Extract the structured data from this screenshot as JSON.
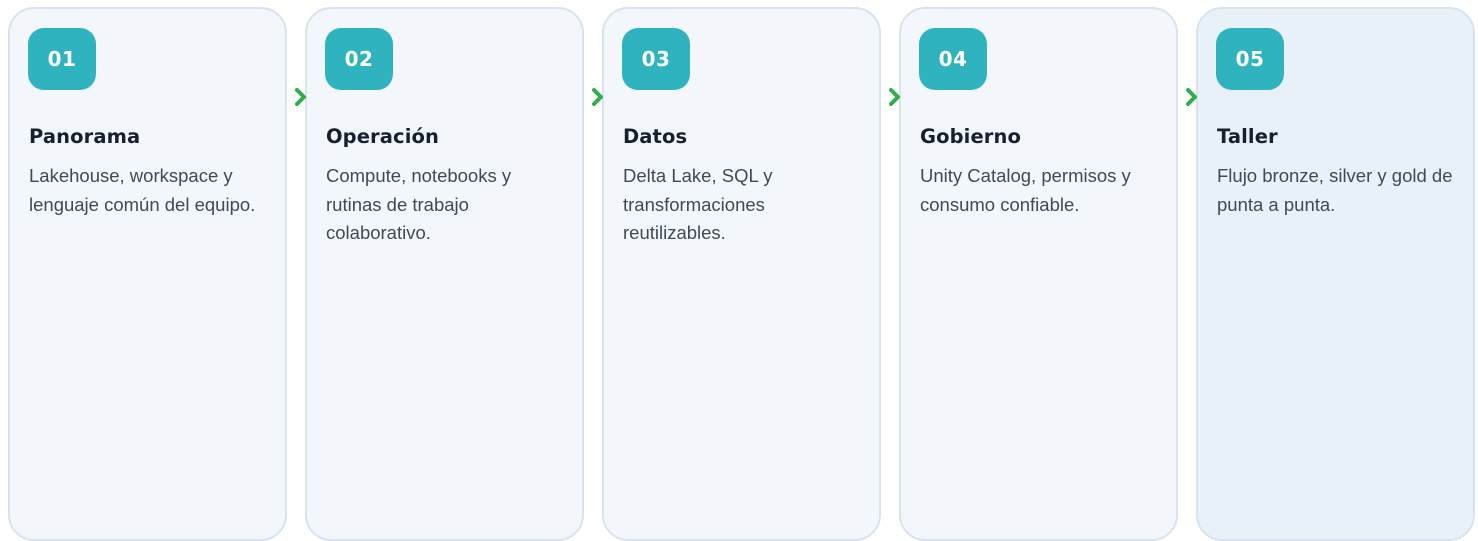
{
  "steps": [
    {
      "number": "01",
      "title": "Panorama",
      "description": "Lakehouse, workspace y lenguaje común del equipo."
    },
    {
      "number": "02",
      "title": "Operación",
      "description": "Compute, notebooks y rutinas de trabajo colaborativo."
    },
    {
      "number": "03",
      "title": "Datos",
      "description": "Delta Lake, SQL y transformaciones reutilizables."
    },
    {
      "number": "04",
      "title": "Gobierno",
      "description": "Unity Catalog, permisos y consumo confiable."
    },
    {
      "number": "05",
      "title": "Taller",
      "description": "Flujo bronze, silver y gold de punta a punta."
    }
  ],
  "colors": {
    "badge": "#2fb3bf",
    "connector": "#2fae4a",
    "card_border": "#d8e3ef",
    "card_background": "#f3f7fb",
    "card_background_last": "#e9f1f8",
    "title_text": "#17202f",
    "body_text": "#3f4958"
  },
  "icons": {
    "connector": "chevron-right-icon"
  }
}
